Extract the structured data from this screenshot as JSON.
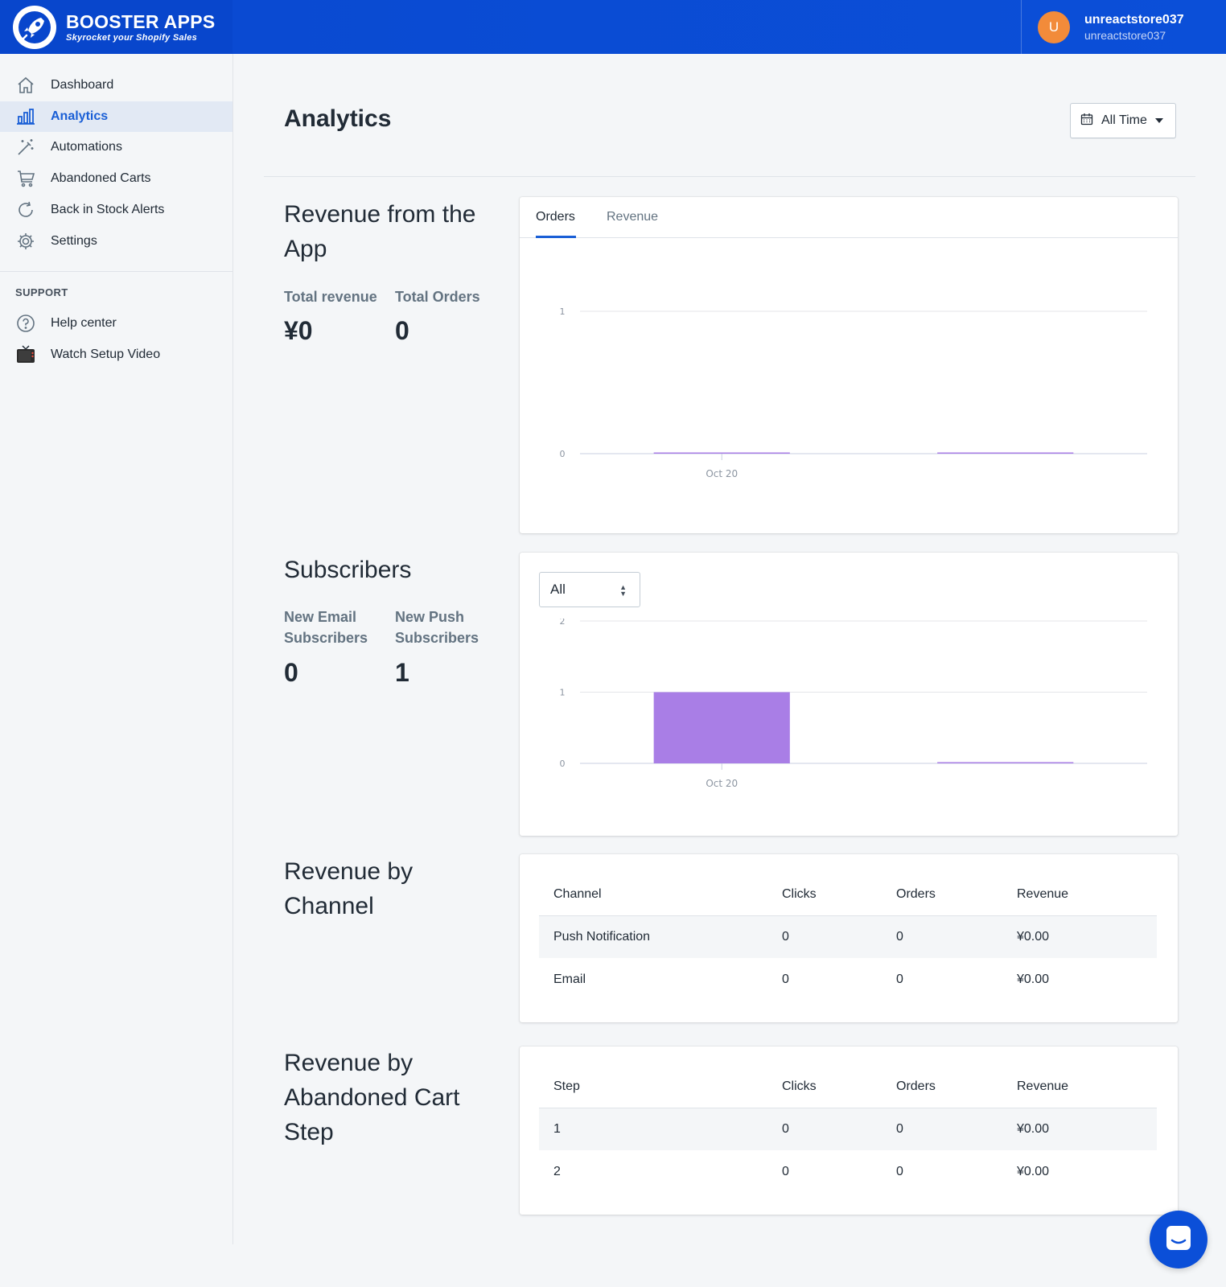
{
  "header": {
    "brand_name": "BOOSTER APPS",
    "brand_tagline": "Skyrocket your Shopify Sales",
    "user_initial": "U",
    "user_name": "unreactstore037",
    "user_store": "unreactstore037"
  },
  "sidebar": {
    "items": [
      {
        "label": "Dashboard",
        "icon": "home-icon"
      },
      {
        "label": "Analytics",
        "icon": "bar-chart-icon",
        "active": true
      },
      {
        "label": "Automations",
        "icon": "magic-wand-icon"
      },
      {
        "label": "Abandoned Carts",
        "icon": "cart-icon"
      },
      {
        "label": "Back in Stock Alerts",
        "icon": "refresh-icon"
      },
      {
        "label": "Settings",
        "icon": "gear-icon"
      }
    ],
    "support_label": "SUPPORT",
    "support_items": [
      {
        "label": "Help center",
        "icon": "question-icon"
      },
      {
        "label": "Watch Setup Video",
        "icon": "tv-icon"
      }
    ]
  },
  "page": {
    "title": "Analytics",
    "time_filter": "All Time"
  },
  "revenue_section": {
    "title": "Revenue from the App",
    "total_revenue_label": "Total revenue",
    "total_revenue_value": "¥0",
    "total_orders_label": "Total Orders",
    "total_orders_value": "0",
    "tabs": [
      "Orders",
      "Revenue"
    ],
    "active_tab": "Orders"
  },
  "subscribers_section": {
    "title": "Subscribers",
    "email_label": "New Email Subscribers",
    "email_value": "0",
    "push_label": "New Push Subscribers",
    "push_value": "1",
    "filter_value": "All"
  },
  "channel_section": {
    "title": "Revenue by Channel",
    "columns": [
      "Channel",
      "Clicks",
      "Orders",
      "Revenue"
    ],
    "rows": [
      [
        "Push Notification",
        "0",
        "0",
        "¥0.00"
      ],
      [
        "Email",
        "0",
        "0",
        "¥0.00"
      ]
    ]
  },
  "step_section": {
    "title": "Revenue by Abandoned Cart Step",
    "columns": [
      "Step",
      "Clicks",
      "Orders",
      "Revenue"
    ],
    "rows": [
      [
        "1",
        "0",
        "0",
        "¥0.00"
      ],
      [
        "2",
        "0",
        "0",
        "¥0.00"
      ]
    ]
  },
  "chart_data": [
    {
      "type": "bar",
      "categories": [
        "Oct 20",
        ""
      ],
      "values": [
        0,
        0
      ],
      "x_tick_labels": [
        "Oct 20"
      ],
      "y_ticks": [
        "0",
        "1"
      ],
      "ylim": [
        0,
        1
      ],
      "grid": true,
      "color": "#a97ee6"
    },
    {
      "type": "bar",
      "categories": [
        "Oct 20",
        ""
      ],
      "values": [
        1,
        0
      ],
      "x_tick_labels": [
        "Oct 20"
      ],
      "y_ticks": [
        "0",
        "1",
        "2"
      ],
      "ylim": [
        0,
        2
      ],
      "grid": true,
      "color": "#a97ee6"
    }
  ]
}
